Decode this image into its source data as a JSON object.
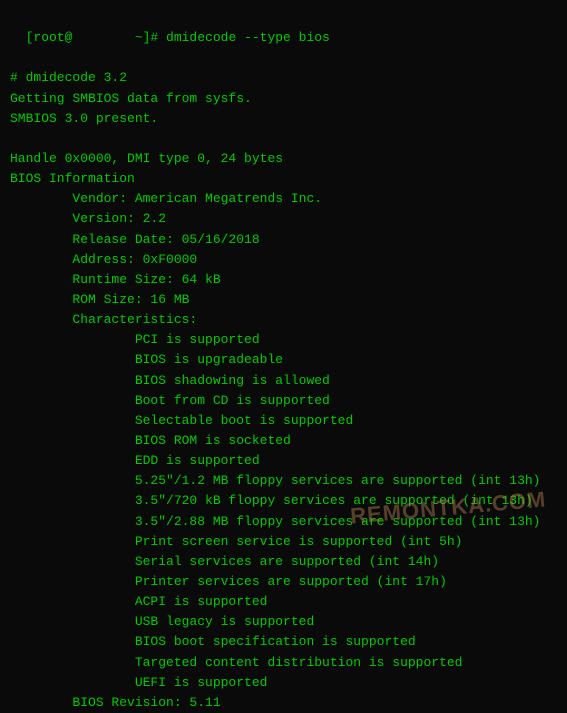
{
  "terminal": {
    "prompt_line": "[root@        ~]# dmidecode --type bios",
    "lines": [
      "# dmidecode 3.2",
      "Getting SMBIOS data from sysfs.",
      "SMBIOS 3.0 present.",
      "",
      "Handle 0x0000, DMI type 0, 24 bytes",
      "BIOS Information",
      "\tVendor: American Megatrends Inc.",
      "\tVersion: 2.2",
      "\tRelease Date: 05/16/2018",
      "\tAddress: 0xF0000",
      "\tRuntime Size: 64 kB",
      "\tROM Size: 16 MB",
      "\tCharacteristics:",
      "\t\tPCI is supported",
      "\t\tBIOS is upgradeable",
      "\t\tBIOS shadowing is allowed",
      "\t\tBoot from CD is supported",
      "\t\tSelectable boot is supported",
      "\t\tBIOS ROM is socketed",
      "\t\tEDD is supported",
      "\t\t5.25\"/1.2 MB floppy services are supported (int 13h)",
      "\t\t3.5\"/720 kB floppy services are supported (int 13h)",
      "\t\t3.5\"/2.88 MB floppy services are supported (int 13h)",
      "\t\tPrint screen service is supported (int 5h)",
      "\t\tSerial services are supported (int 14h)",
      "\t\tPrinter services are supported (int 17h)",
      "\t\tACPI is supported",
      "\t\tUSB legacy is supported",
      "\t\tBIOS boot specification is supported",
      "\t\tTargeted content distribution is supported",
      "\t\tUEFI is supported",
      "\tBIOS Revision: 5.11"
    ]
  },
  "watermark": {
    "text": "REMONTKA.COM"
  }
}
